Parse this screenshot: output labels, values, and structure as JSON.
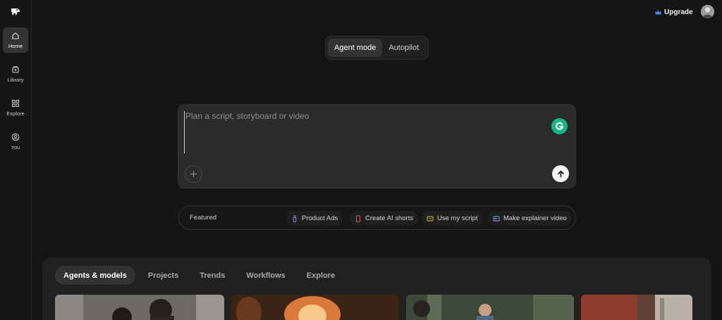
{
  "sidebar": {
    "items": [
      {
        "label": "Home",
        "icon": "home-icon"
      },
      {
        "label": "Library",
        "icon": "library-icon"
      },
      {
        "label": "Explore",
        "icon": "grid-icon"
      },
      {
        "label": "You",
        "icon": "user-icon"
      }
    ]
  },
  "header": {
    "upgrade_label": "Upgrade"
  },
  "mode_toggle": {
    "options": [
      "Agent mode",
      "Autopilot"
    ],
    "selected": "Agent mode"
  },
  "prompt": {
    "placeholder": "Plan a script, storyboard or video",
    "value": ""
  },
  "featured": {
    "label": "Featured",
    "chips": [
      "Product Ads",
      "Create AI shorts",
      "Use my script",
      "Make explainer video"
    ]
  },
  "content_tabs": {
    "items": [
      "Agents & models",
      "Projects",
      "Trends",
      "Workflows",
      "Explore"
    ],
    "selected": "Agents & models"
  },
  "colors": {
    "background": "#141414",
    "accent_upgrade": "#4a8df8",
    "grammarly": "#15b686"
  }
}
